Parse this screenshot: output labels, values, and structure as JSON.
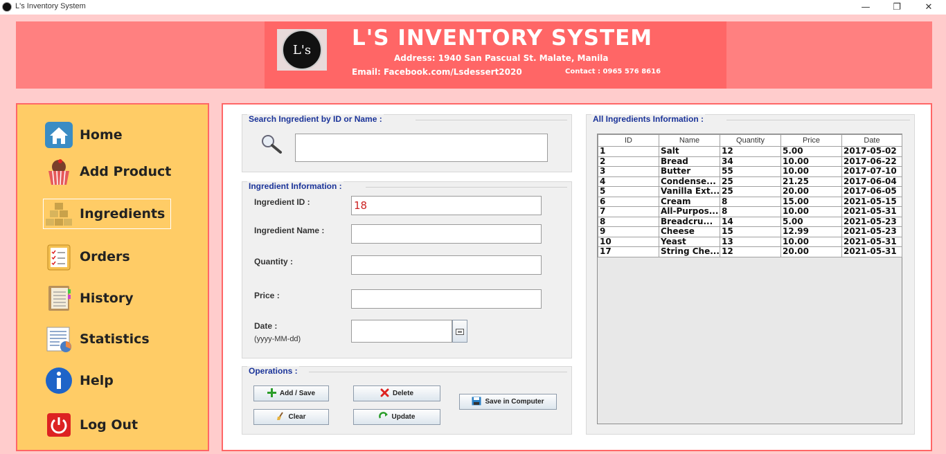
{
  "window": {
    "title": "L's Inventory System",
    "minimize_glyph": "—",
    "restore_glyph": "❐",
    "close_glyph": "✕"
  },
  "header": {
    "logo_text": "L's",
    "title": "L'S INVENTORY SYSTEM",
    "address": "Address: 1940 San Pascual St. Malate, Manila",
    "email": "Email: Facebook.com/Lsdessert2020",
    "contact": "Contact : 0965 576 8616",
    "colors": {
      "header_bg": "#ff8080",
      "banner_bg": "#ff6666",
      "page_bg": "#ffcccc"
    }
  },
  "sidebar": {
    "colors": {
      "bg": "#ffcc66",
      "border": "#ff6666"
    },
    "items": [
      {
        "label": "Home",
        "icon": "home-icon",
        "active": false
      },
      {
        "label": "Add Product",
        "icon": "cupcake-icon",
        "active": false
      },
      {
        "label": "Ingredients",
        "icon": "boxes-icon",
        "active": true
      },
      {
        "label": "Orders",
        "icon": "checklist-icon",
        "active": false
      },
      {
        "label": "History",
        "icon": "notebook-icon",
        "active": false
      },
      {
        "label": "Statistics",
        "icon": "chart-icon",
        "active": false
      },
      {
        "label": "Help",
        "icon": "info-icon",
        "active": false
      },
      {
        "label": "Log Out",
        "icon": "power-icon",
        "active": false
      }
    ]
  },
  "search": {
    "group_title": "Search Ingredient by ID or Name :",
    "value": ""
  },
  "info": {
    "group_title": "Ingredient Information :",
    "id_label": "Ingredient ID :",
    "id_value": "18",
    "name_label": "Ingredient Name :",
    "name_value": "",
    "quantity_label": "Quantity :",
    "quantity_value": "",
    "price_label": "Price :",
    "price_value": "",
    "date_label": "Date :",
    "date_format": "(yyyy-MM-dd)",
    "date_value": ""
  },
  "operations": {
    "group_title": "Operations :",
    "add_save": "Add / Save",
    "delete": "Delete",
    "clear": "Clear",
    "update": "Update",
    "save_computer": "Save in Computer"
  },
  "table": {
    "group_title": "All Ingredients Information :",
    "columns": [
      "ID",
      "Name",
      "Quantity",
      "Price",
      "Date"
    ],
    "rows": [
      [
        "1",
        "Salt",
        "12",
        "5.00",
        "2017-05-02"
      ],
      [
        "2",
        "Bread",
        "34",
        "10.00",
        "2017-06-22"
      ],
      [
        "3",
        "Butter",
        "55",
        "10.00",
        "2017-07-10"
      ],
      [
        "4",
        "Condense...",
        "25",
        "21.25",
        "2017-06-04"
      ],
      [
        "5",
        "Vanilla Ext...",
        "25",
        "20.00",
        "2017-06-05"
      ],
      [
        "6",
        "Cream",
        "8",
        "15.00",
        "2021-05-15"
      ],
      [
        "7",
        "All-Purpos...",
        "8",
        "10.00",
        "2021-05-31"
      ],
      [
        "8",
        "Breadcru...",
        "14",
        "5.00",
        "2021-05-23"
      ],
      [
        "9",
        "Cheese",
        "15",
        "12.99",
        "2021-05-23"
      ],
      [
        "10",
        "Yeast",
        "13",
        "10.00",
        "2021-05-31"
      ],
      [
        "17",
        "String Che...",
        "12",
        "20.00",
        "2021-05-31"
      ]
    ]
  }
}
